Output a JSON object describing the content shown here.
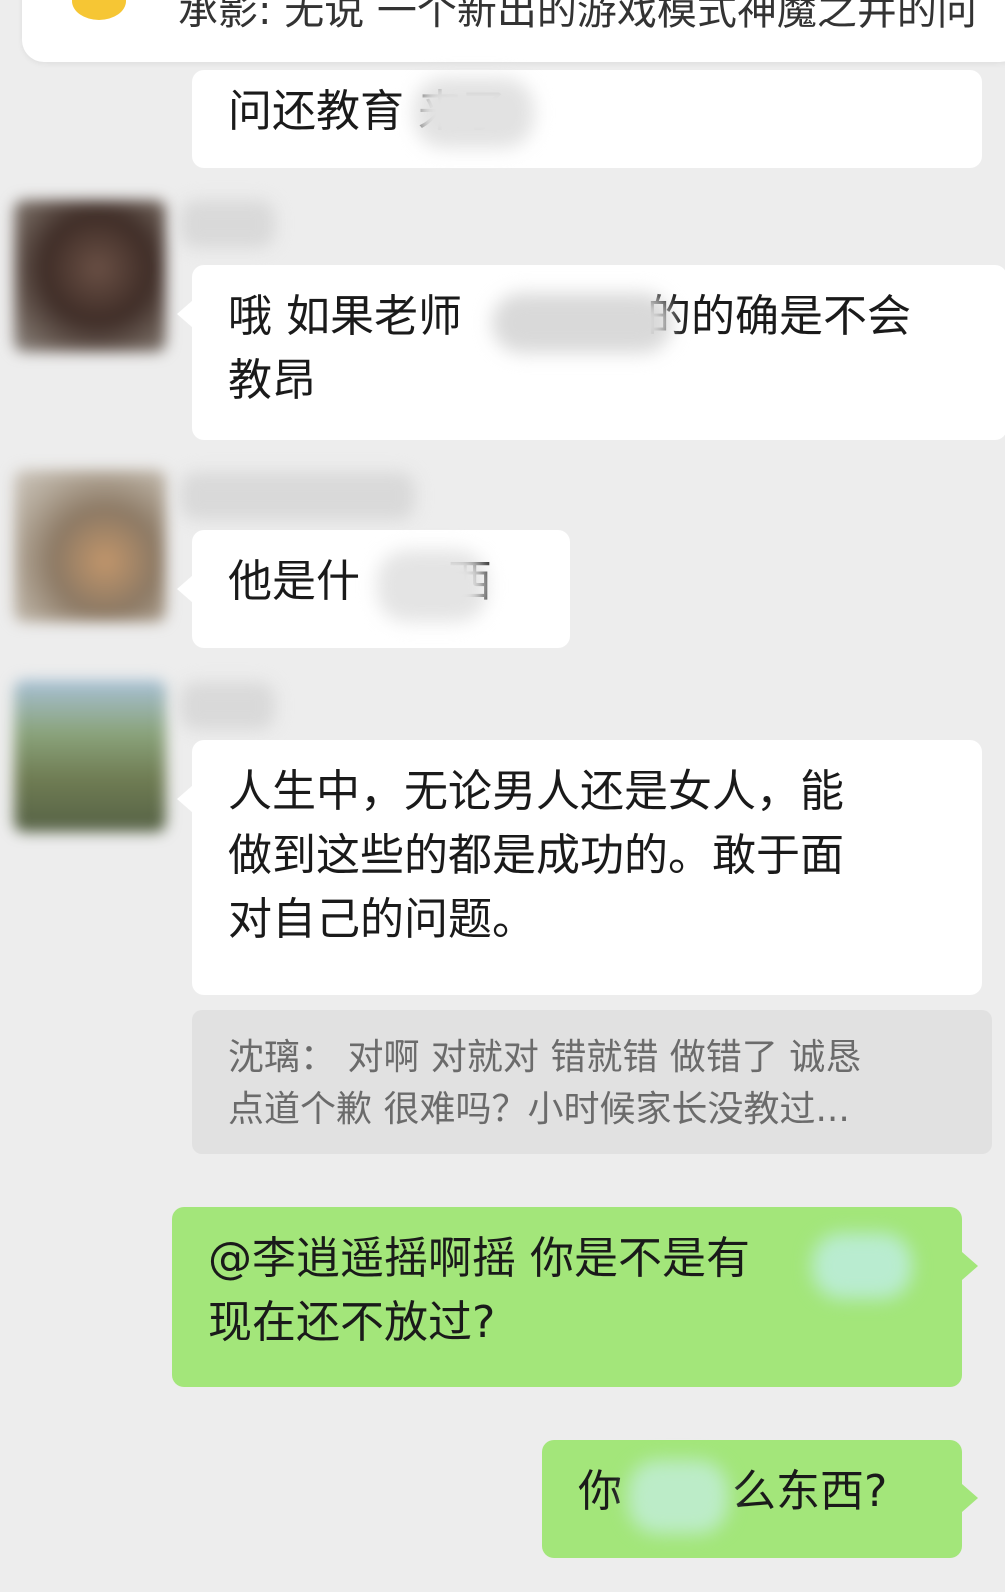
{
  "top_notice": {
    "icon": "speech-bubble-icon",
    "text": "承影: 无说 一个新出的游戏模式神魔之井的问"
  },
  "messages": [
    {
      "sender": "other",
      "text": "问还教育  来了"
    },
    {
      "sender": "other",
      "line1": "哦 如果老师",
      "line1b": "的的确是不会",
      "line2": "教昂"
    },
    {
      "sender": "other",
      "part1": "他是什",
      "part2": "西"
    },
    {
      "sender": "other",
      "line1": "人生中，无论男人还是女人，能",
      "line2": "做到这些的都是成功的。敢于面",
      "line3": "对自己的问题。"
    },
    {
      "sender": "quote",
      "line1": "沈璃：  对啊 对就对 错就错 做错了 诚恳",
      "line2": "点道个歉 很难吗？小时候家长没教过..."
    },
    {
      "sender": "self",
      "line1": "@李逍遥摇啊摇 你是不是有",
      "line2": "现在还不放过?"
    },
    {
      "sender": "self",
      "part1": "你",
      "part2": "么东西?"
    }
  ],
  "colors": {
    "background": "#ededed",
    "incoming_bubble": "#ffffff",
    "outgoing_bubble": "#a3e67a",
    "quote": "#e1e1e1"
  }
}
